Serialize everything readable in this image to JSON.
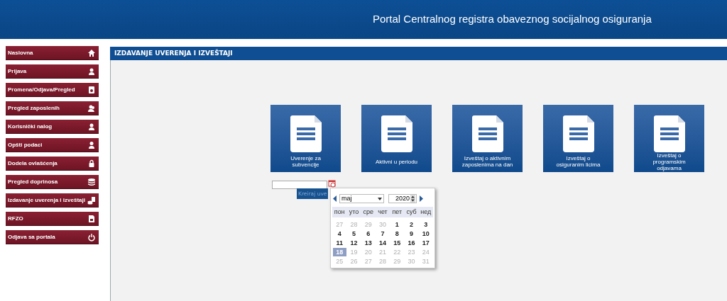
{
  "header": {
    "title": "Portal Centralnog registra obaveznog socijalnog osiguranja"
  },
  "sidebar": {
    "items": [
      {
        "label": "Naslovna"
      },
      {
        "label": "Prijava"
      },
      {
        "label": "Promena/Odjava/Pregled"
      },
      {
        "label": "Pregled zaposlenih"
      },
      {
        "label": "Korisnički nalog"
      },
      {
        "label": "Opšti podaci"
      },
      {
        "label": "Dodela ovlašćenja"
      },
      {
        "label": "Pregled doprinosa"
      },
      {
        "label": "Izdavanje uverenja i izveštaji"
      },
      {
        "label": "RFZO"
      },
      {
        "label": "Odjava sa portala"
      }
    ]
  },
  "panel": {
    "title": "IZDAVANJE UVERENJA I IZVEŠTAJI",
    "tiles": [
      {
        "label": "Uverenje za subvencije"
      },
      {
        "label": "Aktivni u periodu"
      },
      {
        "label": "Izveštaj o aktivnim zaposlenima na dan"
      },
      {
        "label": "Izveštaj o osiguranim licima"
      },
      {
        "label": "Izveštaj o programskim odjavama"
      }
    ],
    "create_button": "Kreiraj uve"
  },
  "datepicker": {
    "month": "maj",
    "year": "2020",
    "weekdays": [
      "пон",
      "уто",
      "сре",
      "чет",
      "пет",
      "суб",
      "нед"
    ],
    "weeks": [
      [
        {
          "day": "27",
          "muted": true,
          "selected": false
        },
        {
          "day": "28",
          "muted": true,
          "selected": false
        },
        {
          "day": "29",
          "muted": true,
          "selected": false
        },
        {
          "day": "30",
          "muted": true,
          "selected": false
        },
        {
          "day": "1",
          "muted": false,
          "selected": false
        },
        {
          "day": "2",
          "muted": false,
          "selected": false
        },
        {
          "day": "3",
          "muted": false,
          "selected": false
        }
      ],
      [
        {
          "day": "4",
          "muted": false,
          "selected": false
        },
        {
          "day": "5",
          "muted": false,
          "selected": false
        },
        {
          "day": "6",
          "muted": false,
          "selected": false
        },
        {
          "day": "7",
          "muted": false,
          "selected": false
        },
        {
          "day": "8",
          "muted": false,
          "selected": false
        },
        {
          "day": "9",
          "muted": false,
          "selected": false
        },
        {
          "day": "10",
          "muted": false,
          "selected": false
        }
      ],
      [
        {
          "day": "11",
          "muted": false,
          "selected": false
        },
        {
          "day": "12",
          "muted": false,
          "selected": false
        },
        {
          "day": "13",
          "muted": false,
          "selected": false
        },
        {
          "day": "14",
          "muted": false,
          "selected": false
        },
        {
          "day": "15",
          "muted": false,
          "selected": false
        },
        {
          "day": "16",
          "muted": false,
          "selected": false
        },
        {
          "day": "17",
          "muted": false,
          "selected": false
        }
      ],
      [
        {
          "day": "18",
          "muted": false,
          "selected": true
        },
        {
          "day": "19",
          "muted": true,
          "selected": false
        },
        {
          "day": "20",
          "muted": true,
          "selected": false
        },
        {
          "day": "21",
          "muted": true,
          "selected": false
        },
        {
          "day": "22",
          "muted": true,
          "selected": false
        },
        {
          "day": "23",
          "muted": true,
          "selected": false
        },
        {
          "day": "24",
          "muted": true,
          "selected": false
        }
      ],
      [
        {
          "day": "25",
          "muted": true,
          "selected": false
        },
        {
          "day": "26",
          "muted": true,
          "selected": false
        },
        {
          "day": "27",
          "muted": true,
          "selected": false
        },
        {
          "day": "28",
          "muted": true,
          "selected": false
        },
        {
          "day": "29",
          "muted": true,
          "selected": false
        },
        {
          "day": "30",
          "muted": true,
          "selected": false
        },
        {
          "day": "31",
          "muted": true,
          "selected": false
        }
      ]
    ]
  }
}
